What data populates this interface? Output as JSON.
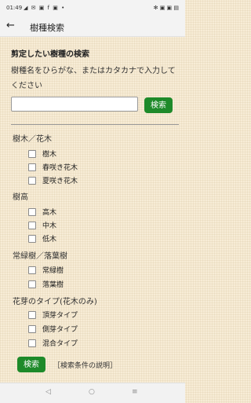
{
  "statusbar": {
    "time": "01:49",
    "left_icons": "◢ ✉ ▣ f ▣ •",
    "right_icons": "✻ ▣ ▣ ▤"
  },
  "appbar": {
    "back": "←",
    "title": "樹種検索"
  },
  "search": {
    "heading": "剪定したい樹種の検索",
    "instruction": "樹種名をひらがな、またはカタカナで入力してください",
    "input_value": "",
    "button_label": "検索"
  },
  "groups": [
    {
      "label": "樹木／花木",
      "options": [
        "樹木",
        "春咲き花木",
        "夏咲き花木"
      ]
    },
    {
      "label": "樹高",
      "options": [
        "高木",
        "中木",
        "低木"
      ]
    },
    {
      "label": "常緑樹／落葉樹",
      "options": [
        "常緑樹",
        "落葉樹"
      ]
    },
    {
      "label": "花芽のタイプ(花木のみ)",
      "options": [
        "頂芽タイプ",
        "側芽タイプ",
        "混合タイプ"
      ]
    }
  ],
  "footer": {
    "button_label": "検索",
    "explain_link": "［検索条件の説明］"
  },
  "navbar": {
    "back": "◁",
    "home": "○",
    "recents": "≡"
  },
  "colors": {
    "accent": "#1e8a2a",
    "background": "#f7ecd6"
  }
}
